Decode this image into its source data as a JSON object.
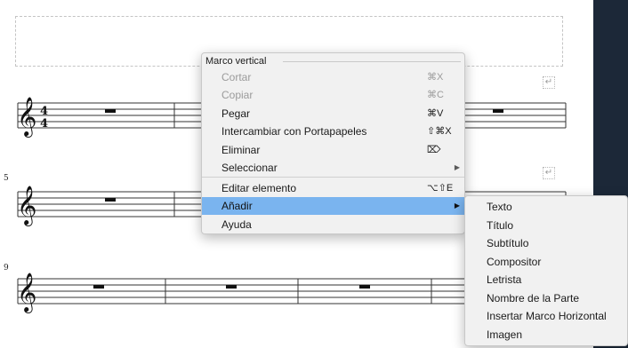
{
  "context_menu": {
    "header": "Marco vertical",
    "items": [
      {
        "label": "Cortar",
        "shortcut": "⌘X",
        "disabled": true
      },
      {
        "label": "Copiar",
        "shortcut": "⌘C",
        "disabled": true
      },
      {
        "label": "Pegar",
        "shortcut": "⌘V"
      },
      {
        "label": "Intercambiar con Portapapeles",
        "shortcut": "⇧⌘X"
      },
      {
        "label": "Eliminar",
        "shortcut": "⌦"
      },
      {
        "label": "Seleccionar",
        "has_submenu": true
      },
      {
        "label": "Editar elemento",
        "shortcut": "⌥⇧E"
      },
      {
        "label": "Añadir",
        "has_submenu": true,
        "highlighted": true
      },
      {
        "label": "Ayuda"
      }
    ]
  },
  "submenu_add": {
    "items": [
      "Texto",
      "Título",
      "Subtítulo",
      "Compositor",
      "Letrista",
      "Nombre de la Parte",
      "Insertar Marco Horizontal",
      "Imagen"
    ]
  },
  "score": {
    "treble_clef": "𝄞",
    "time_signature_top": "4",
    "time_signature_bottom": "4",
    "measure_numbers": [
      "5",
      "9"
    ],
    "return_icon": "↵"
  },
  "colors": {
    "highlight": "#7ab4ef",
    "side_panel": "#1c2838",
    "menu_bg": "#f1f1f1"
  }
}
